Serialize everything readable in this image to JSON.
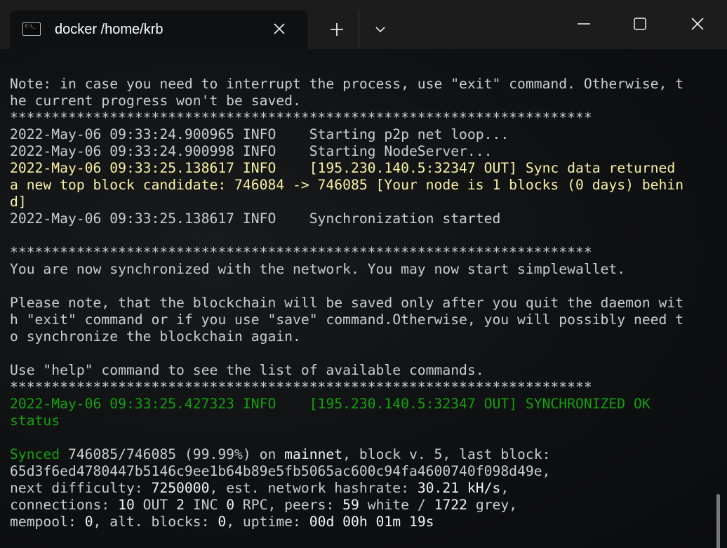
{
  "window": {
    "tab_title": "docker /home/krb",
    "tab_icon": "terminal-icon",
    "tab_close_icon": "close-icon",
    "new_tab_icon": "plus-icon",
    "dropdown_icon": "chevron-down-icon",
    "minimize_icon": "minimize-icon",
    "maximize_icon": "maximize-icon",
    "close_icon": "close-icon"
  },
  "colors": {
    "default_text": "#cccccc",
    "yellow_text": "#f9f1a5",
    "green_text": "#13a10e",
    "bright_text": "#f2f2f2"
  },
  "terminal": {
    "lines": [
      {
        "segments": [
          {
            "text": "Note: in case you need to interrupt the process, use \"exit\" command. Otherwise, t",
            "style": "default"
          }
        ]
      },
      {
        "segments": [
          {
            "text": "he current progress won't be saved.",
            "style": "default"
          }
        ]
      },
      {
        "segments": [
          {
            "text": "**********************************************************************",
            "style": "default"
          }
        ]
      },
      {
        "segments": [
          {
            "text": "2022-May-06 09:33:24.900965 INFO    Starting p2p net loop...",
            "style": "default"
          }
        ]
      },
      {
        "segments": [
          {
            "text": "2022-May-06 09:33:24.900998 INFO    Starting NodeServer...",
            "style": "default"
          }
        ]
      },
      {
        "segments": [
          {
            "text": "2022-May-06 09:33:25.138617 INFO    [195.230.140.5:32347 OUT] Sync data returned",
            "style": "yellow"
          }
        ]
      },
      {
        "segments": [
          {
            "text": "a new top block candidate: 746084 -> 746085 [Your node is 1 blocks (0 days) behin",
            "style": "yellow"
          }
        ]
      },
      {
        "segments": [
          {
            "text": "d]",
            "style": "yellow"
          }
        ]
      },
      {
        "segments": [
          {
            "text": "2022-May-06 09:33:25.138617 INFO    Synchronization started",
            "style": "default"
          }
        ]
      },
      {
        "segments": [
          {
            "text": "",
            "style": "default"
          }
        ]
      },
      {
        "segments": [
          {
            "text": "**********************************************************************",
            "style": "default"
          }
        ]
      },
      {
        "segments": [
          {
            "text": "You are now synchronized with the network. You may now start simplewallet.",
            "style": "default"
          }
        ]
      },
      {
        "segments": [
          {
            "text": "",
            "style": "default"
          }
        ]
      },
      {
        "segments": [
          {
            "text": "Please note, that the blockchain will be saved only after you quit the daemon wit",
            "style": "default"
          }
        ]
      },
      {
        "segments": [
          {
            "text": "h \"exit\" command or if you use \"save\" command.Otherwise, you will possibly need t",
            "style": "default"
          }
        ]
      },
      {
        "segments": [
          {
            "text": "o synchronize the blockchain again.",
            "style": "default"
          }
        ]
      },
      {
        "segments": [
          {
            "text": "",
            "style": "default"
          }
        ]
      },
      {
        "segments": [
          {
            "text": "Use \"help\" command to see the list of available commands.",
            "style": "default"
          }
        ]
      },
      {
        "segments": [
          {
            "text": "**********************************************************************",
            "style": "default"
          }
        ]
      },
      {
        "segments": [
          {
            "text": "2022-May-06 09:33:25.427323 INFO    [195.230.140.5:32347 OUT] SYNCHRONIZED OK",
            "style": "green"
          }
        ]
      },
      {
        "segments": [
          {
            "text": "status",
            "style": "green"
          }
        ]
      },
      {
        "segments": [
          {
            "text": "",
            "style": "default"
          }
        ]
      },
      {
        "segments": [
          {
            "text": "Synced",
            "style": "green"
          },
          {
            "text": " 746085/746085 (99.99%) on ",
            "style": "default"
          },
          {
            "text": "mainnet",
            "style": "bright"
          },
          {
            "text": ", block v. 5, last block:",
            "style": "default"
          }
        ]
      },
      {
        "segments": [
          {
            "text": "65d3f6ed4780447b5146c9ee1b64b89e5fb5065ac600c94fa4600740f098d49e,",
            "style": "default"
          }
        ]
      },
      {
        "segments": [
          {
            "text": "next difficulty: ",
            "style": "default"
          },
          {
            "text": "7250000",
            "style": "bright"
          },
          {
            "text": ", est. network hashrate: ",
            "style": "default"
          },
          {
            "text": "30.21 kH/s",
            "style": "bright"
          },
          {
            "text": ",",
            "style": "default"
          }
        ]
      },
      {
        "segments": [
          {
            "text": "connections: ",
            "style": "default"
          },
          {
            "text": "10",
            "style": "bright"
          },
          {
            "text": " OUT ",
            "style": "default"
          },
          {
            "text": "2",
            "style": "bright"
          },
          {
            "text": " INC ",
            "style": "default"
          },
          {
            "text": "0",
            "style": "bright"
          },
          {
            "text": " RPC, peers: ",
            "style": "default"
          },
          {
            "text": "59",
            "style": "bright"
          },
          {
            "text": " white / ",
            "style": "default"
          },
          {
            "text": "1722",
            "style": "bright"
          },
          {
            "text": " grey,",
            "style": "default"
          }
        ]
      },
      {
        "segments": [
          {
            "text": "mempool: ",
            "style": "default"
          },
          {
            "text": "0",
            "style": "bright"
          },
          {
            "text": ", alt. blocks: ",
            "style": "default"
          },
          {
            "text": "0",
            "style": "bright"
          },
          {
            "text": ", uptime: ",
            "style": "default"
          },
          {
            "text": "00d 00h 01m 19s",
            "style": "bright"
          }
        ]
      }
    ]
  }
}
